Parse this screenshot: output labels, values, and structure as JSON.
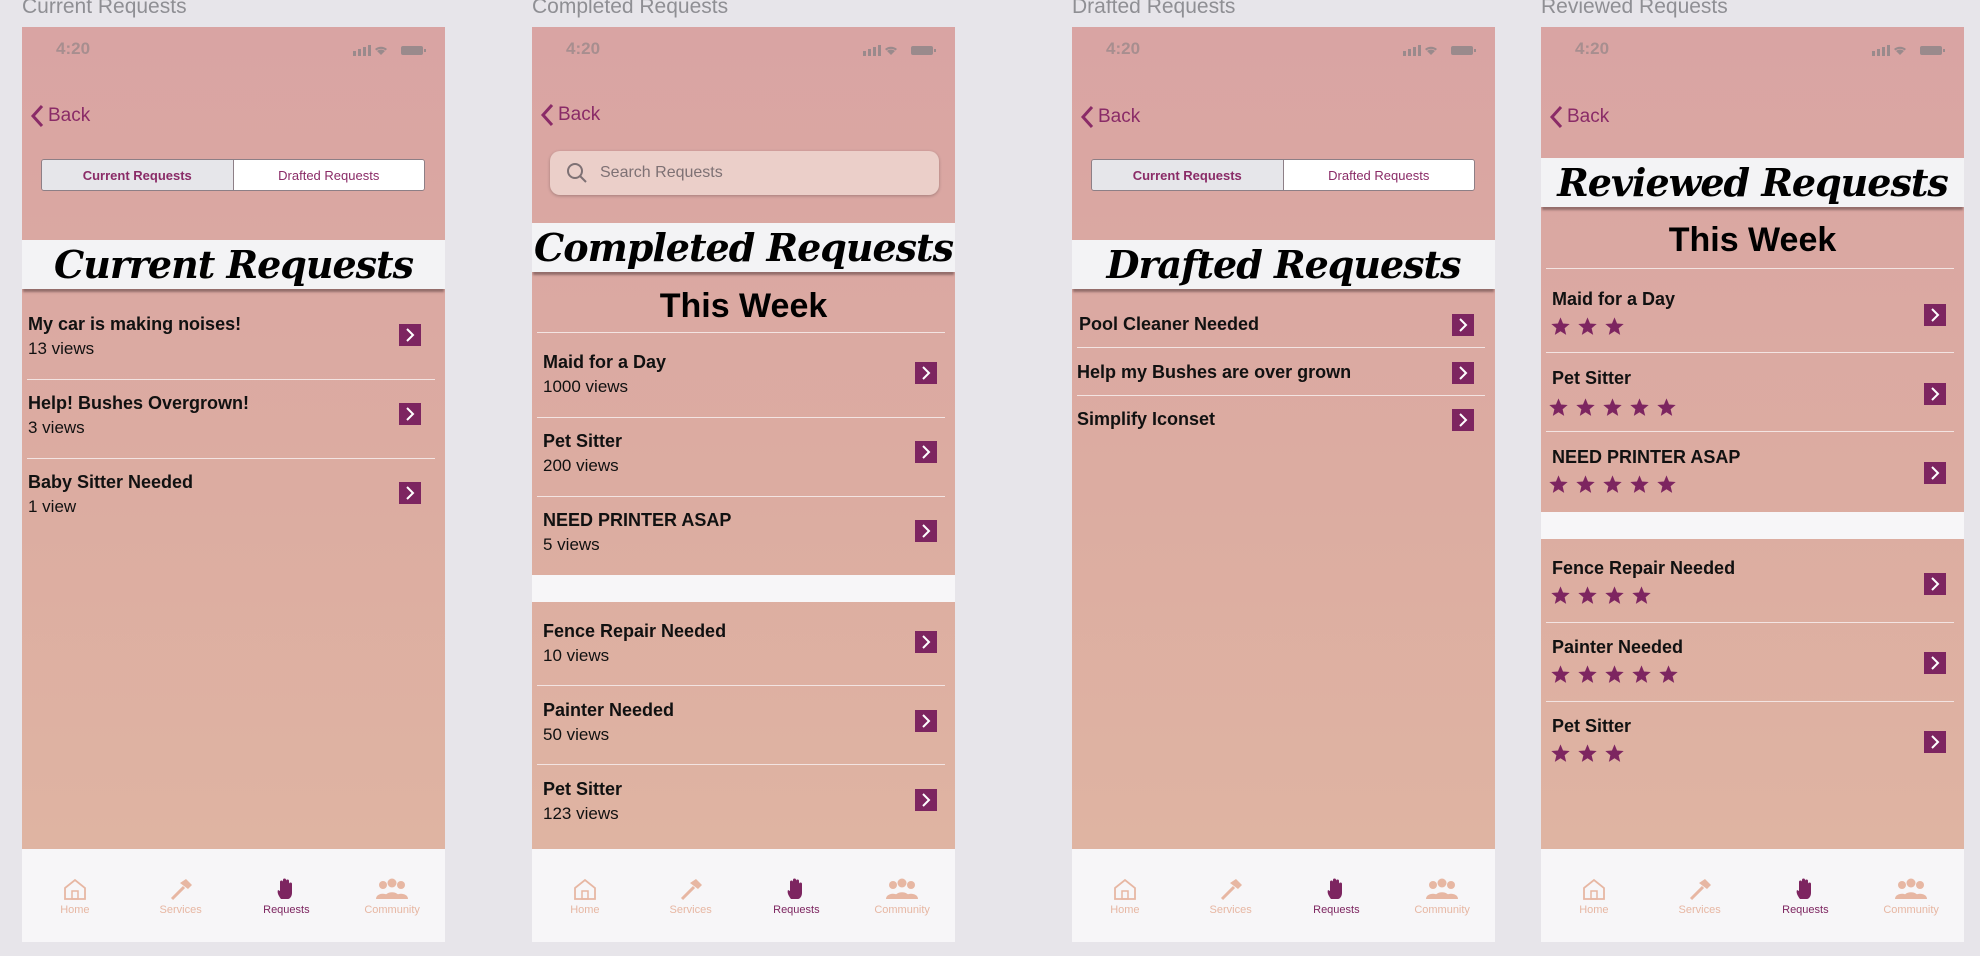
{
  "colors": {
    "accent": "#7d2560",
    "text_accent": "#8a2b67",
    "inactive_tab": "#e7b7a3",
    "banner_bg": "#f3f3f5"
  },
  "status": {
    "time": "4:20"
  },
  "back_label": "Back",
  "segmented": {
    "current": "Current Requests",
    "drafted": "Drafted Requests"
  },
  "tabbar": [
    {
      "label": "Home",
      "icon": "home-icon"
    },
    {
      "label": "Services",
      "icon": "hammer-icon"
    },
    {
      "label": "Requests",
      "icon": "hand-icon",
      "active": true
    },
    {
      "label": "Community",
      "icon": "people-icon"
    }
  ],
  "screens": {
    "current": {
      "frame_title": "Current Requests",
      "banner": "Current Requests",
      "items": [
        {
          "title": "My car is making noises!",
          "sub": "13 views"
        },
        {
          "title": "Help! Bushes Overgrown!",
          "sub": "3 views"
        },
        {
          "title": "Baby Sitter Needed",
          "sub": "1 view"
        }
      ]
    },
    "completed": {
      "frame_title": "Completed Requests",
      "search_placeholder": "Search Requests",
      "banner": "Completed Requests",
      "week": "This Week",
      "items": [
        {
          "title": "Maid for a Day",
          "sub": "1000 views"
        },
        {
          "title": "Pet Sitter",
          "sub": "200 views"
        },
        {
          "title": "NEED PRINTER ASAP",
          "sub": "5 views"
        },
        {
          "title": "Fence Repair Needed",
          "sub": "10 views"
        },
        {
          "title": "Painter Needed",
          "sub": "50 views"
        },
        {
          "title": "Pet Sitter",
          "sub": "123 views"
        }
      ]
    },
    "drafted": {
      "frame_title": "Drafted Requests",
      "banner": "Drafted Requests",
      "items": [
        {
          "title": "Pool Cleaner Needed"
        },
        {
          "title": "Help my Bushes are over grown"
        },
        {
          "title": "Simplify Iconset"
        }
      ]
    },
    "reviewed": {
      "frame_title": "Reviewed Requests",
      "banner": "Reviewed Requests",
      "week": "This Week",
      "items": [
        {
          "title": "Maid for a Day",
          "stars": 3
        },
        {
          "title": "Pet Sitter",
          "stars": 5
        },
        {
          "title": "NEED PRINTER ASAP",
          "stars": 5
        },
        {
          "title": "Fence Repair Needed",
          "stars": 4
        },
        {
          "title": "Painter Needed",
          "stars": 5
        },
        {
          "title": "Pet Sitter",
          "stars": 3
        }
      ]
    }
  }
}
